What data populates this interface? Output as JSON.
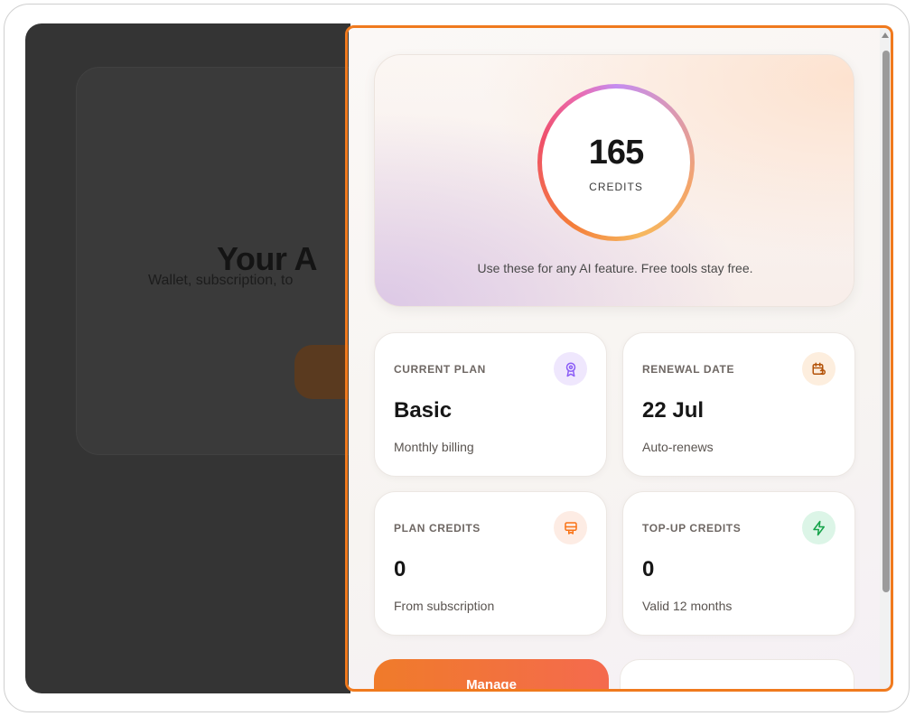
{
  "background": {
    "title": "Your A",
    "subtitle": "Wallet, subscription, to"
  },
  "wallet": {
    "credits_value": "165",
    "credits_label": "CREDITS",
    "caption": "Use these for any AI feature. Free tools stay free."
  },
  "cards": [
    {
      "label": "CURRENT PLAN",
      "value": "Basic",
      "sub": "Monthly billing",
      "icon": "award-ribbon-icon",
      "icon_color": "#8b5cf6",
      "icon_bg": "#efe7fd"
    },
    {
      "label": "RENEWAL DATE",
      "value": "22 Jul",
      "sub": "Auto-renews",
      "icon": "calendar-refresh-icon",
      "icon_color": "#b45309",
      "icon_bg": "#fdeede"
    },
    {
      "label": "PLAN CREDITS",
      "value": "0",
      "sub": "From subscription",
      "icon": "plan-badge-icon",
      "icon_color": "#f97316",
      "icon_bg": "#fdece4"
    },
    {
      "label": "TOP-UP CREDITS",
      "value": "0",
      "sub": "Valid 12 months",
      "icon": "lightning-bolt-icon",
      "icon_color": "#16a34a",
      "icon_bg": "#dcf5e7"
    }
  ],
  "actions": {
    "manage_label": "Manage"
  },
  "colors": {
    "accent": "#f07a1e",
    "overlay": "#343434"
  }
}
